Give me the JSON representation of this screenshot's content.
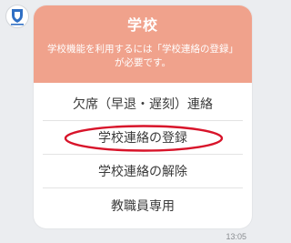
{
  "chat": {
    "sender_icon": "school-emblem-icon",
    "timestamp": "13:05"
  },
  "card": {
    "header_color": "#f0a28c",
    "title": "学校",
    "description_line1": "学校機能を利用するには「学校連絡の登録」",
    "description_line2": "が必要です。",
    "options": [
      {
        "label": "欠席（早退・遅刻）連絡"
      },
      {
        "label": "学校連絡の登録",
        "highlighted": true,
        "highlight_color": "#d8142a"
      },
      {
        "label": "学校連絡の解除"
      },
      {
        "label": "教職員専用"
      }
    ]
  }
}
